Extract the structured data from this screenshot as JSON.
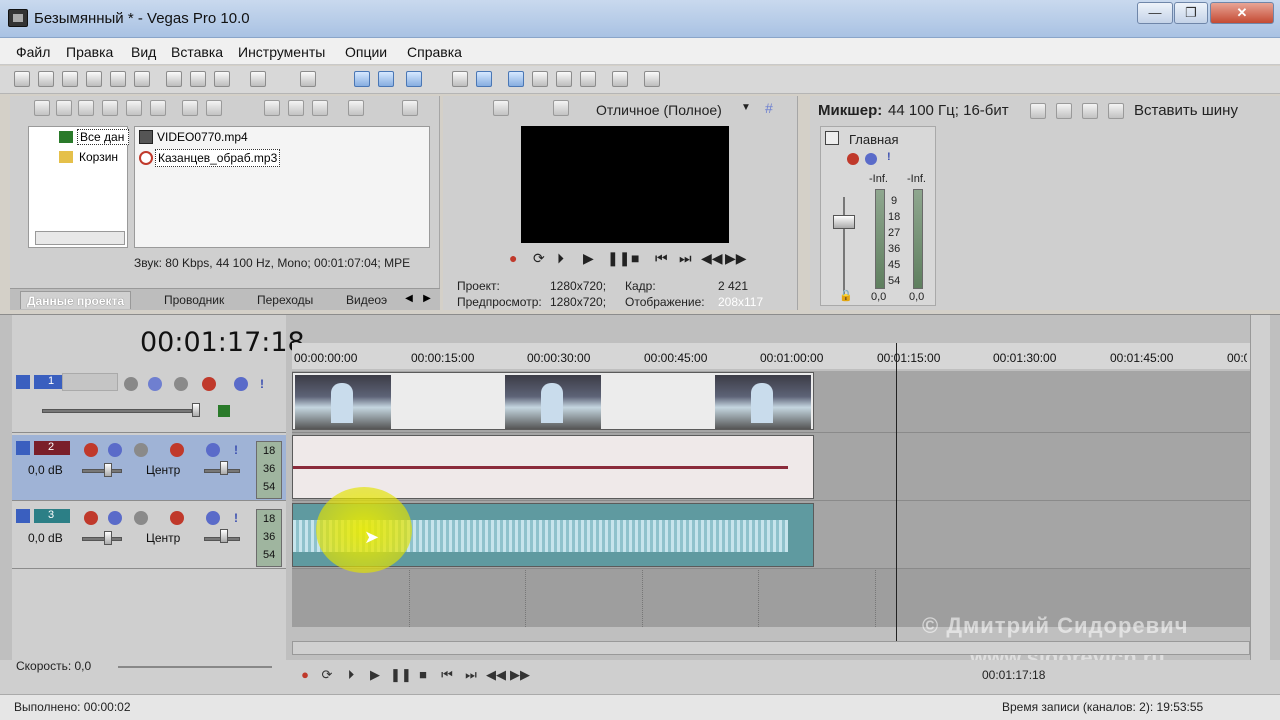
{
  "window": {
    "title": "Безымянный * - Vegas Pro 10.0",
    "minimize": "—",
    "maximize": "❐",
    "close": "✕"
  },
  "menu": [
    "Файл",
    "Правка",
    "Вид",
    "Вставка",
    "Инструменты",
    "Опции",
    "Справка"
  ],
  "project": {
    "tree": [
      "Все дан",
      "Корзин"
    ],
    "files": [
      "VIDEO0770.mp4",
      "Казанцев_обраб.mp3"
    ],
    "media_info": "Звук: 80 Kbps, 44 100 Hz, Mono; 00:01:07:04; MPE",
    "tabs": [
      "Данные проекта",
      "Проводник",
      "Переходы",
      "Видеоэ"
    ]
  },
  "preview": {
    "quality": "Отличное (Полное)",
    "project_label": "Проект:",
    "project_value": "1280x720;",
    "frame_label": "Кадр:",
    "frame_value": "2 421",
    "preview_label": "Предпросмотр:",
    "preview_value": "1280x720;",
    "display_label": "Отображение:",
    "display_value": "208x117"
  },
  "mixer": {
    "title": "Микшер:",
    "format": "44 100 Гц; 16-бит",
    "insert_bus": "Вставить шину",
    "main_label": "Главная",
    "peak_l": "-Inf.",
    "peak_r": "-Inf.",
    "scale": [
      "9",
      "18",
      "27",
      "36",
      "45",
      "54"
    ],
    "val_l": "0,0",
    "val_r": "0,0"
  },
  "timeline": {
    "timecode": "00:01:17:18",
    "ruler": [
      "00:00:00:00",
      "00:00:15:00",
      "00:00:30:00",
      "00:00:45:00",
      "00:01:00:00",
      "00:01:15:00",
      "00:01:30:00",
      "00:01:45:00",
      "00:0"
    ],
    "tracks": [
      {
        "num": "1"
      },
      {
        "num": "2",
        "volume": "0,0 dB",
        "pan": "Центр",
        "meter": [
          "18",
          "36",
          "54"
        ]
      },
      {
        "num": "3",
        "volume": "0,0 dB",
        "pan": "Центр",
        "meter": [
          "18",
          "36",
          "54"
        ]
      }
    ],
    "watermark": "© Дмитрий Сидоревич",
    "watermark_url": "www.sidorevich.ru"
  },
  "bottom": {
    "speed": "Скорость: 0,0",
    "done": "Выполнено: 00:00:02",
    "cursor_time": "00:01:17:18",
    "record_time": "Время записи (каналов: 2): 19:53:55"
  },
  "colors": {
    "track2_color": "#7a1f2a",
    "track3_color": "#2c7f86",
    "video_color": "#3a5fbf",
    "audio3_wave": "#c6e4ec",
    "audio2_wave": "#8b2b3b"
  }
}
